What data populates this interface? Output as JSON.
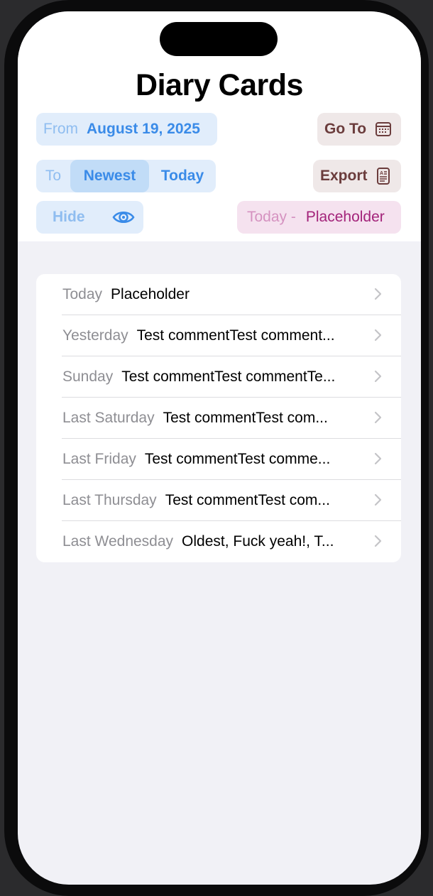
{
  "header": {
    "title": "Diary Cards",
    "from_label": "From",
    "from_date": "August 19, 2025",
    "goto_label": "Go To",
    "to_label": "To",
    "to_options": [
      "Newest",
      "Today"
    ],
    "to_selected": "Newest",
    "export_label": "Export",
    "hide_label": "Hide",
    "today_label": "Today -",
    "today_value": "Placeholder"
  },
  "entries": [
    {
      "day": "Today",
      "text": "Placeholder"
    },
    {
      "day": "Yesterday",
      "text": "Test commentTest comment..."
    },
    {
      "day": "Sunday",
      "text": "Test commentTest commentTe..."
    },
    {
      "day": "Last Saturday",
      "text": "Test commentTest com..."
    },
    {
      "day": "Last Friday",
      "text": "Test commentTest comme..."
    },
    {
      "day": "Last Thursday",
      "text": "Test commentTest com..."
    },
    {
      "day": "Last Wednesday",
      "text": "Oldest, Fuck yeah!, T..."
    }
  ],
  "colors": {
    "accent_blue": "#3a8be8",
    "light_blue": "#8fbdf0",
    "brown": "#6b3c3c",
    "magenta": "#a3237a",
    "background": "#f1f1f6"
  },
  "icons": {
    "goto": "calendar-icon",
    "export": "document-icon",
    "hide": "eye-icon",
    "row": "chevron-right-icon"
  }
}
